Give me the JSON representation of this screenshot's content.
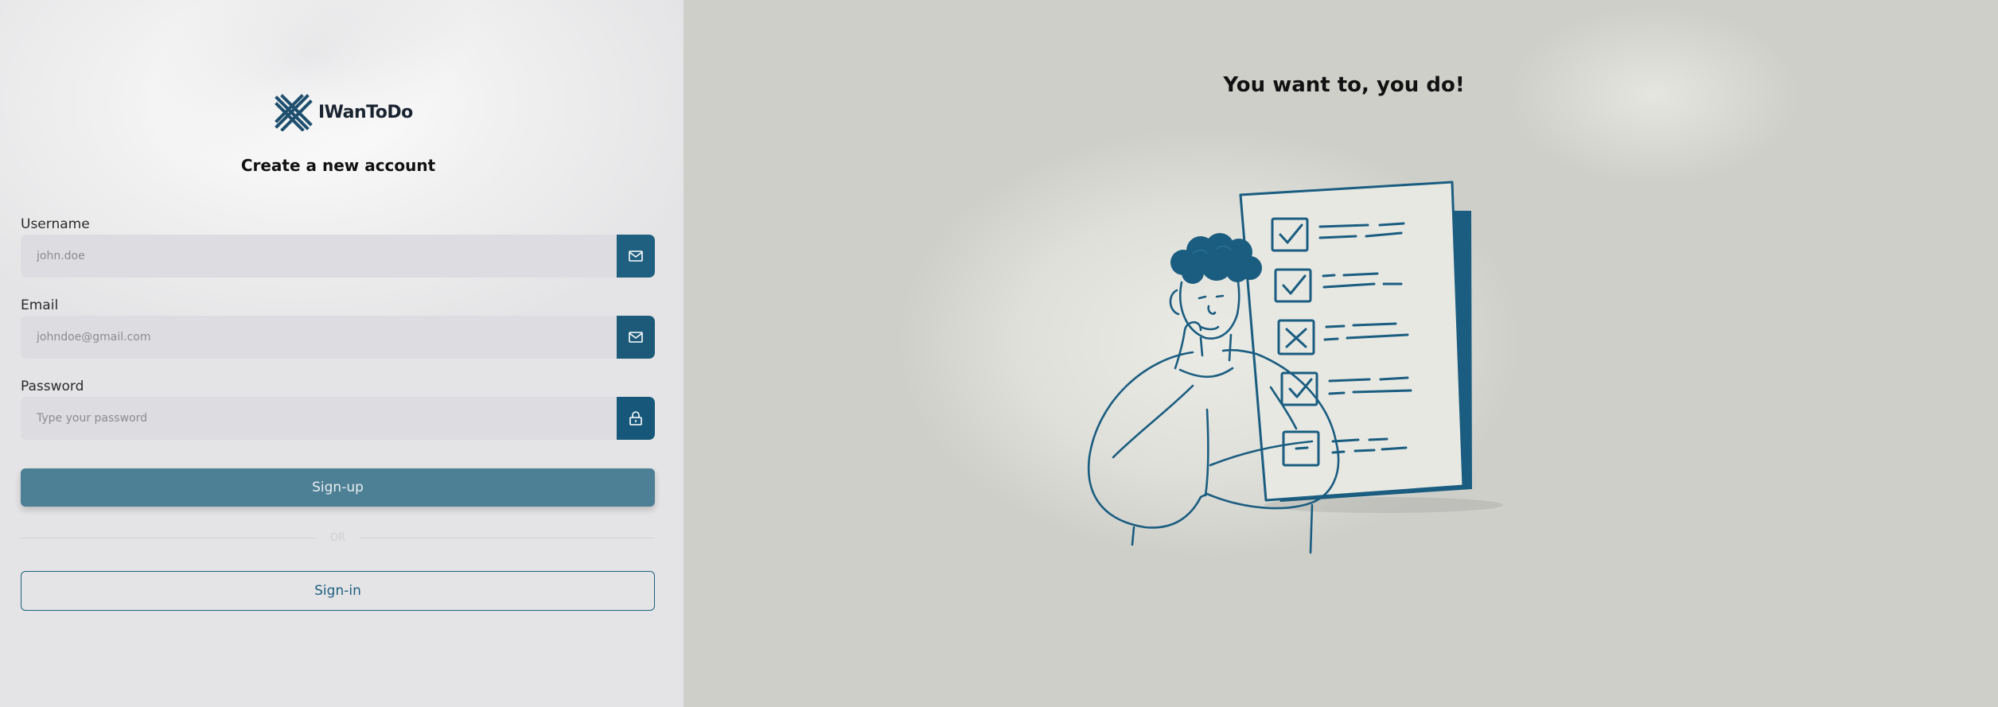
{
  "brand": {
    "name": "IWanToDo"
  },
  "form": {
    "title": "Create a new account",
    "username": {
      "label": "Username",
      "placeholder": "john.doe",
      "icon": "mail-icon"
    },
    "email": {
      "label": "Email",
      "placeholder": "johndoe@gmail.com",
      "icon": "mail-icon"
    },
    "password": {
      "label": "Password",
      "placeholder": "Type your password",
      "icon": "lock-icon"
    },
    "signup_label": "Sign-up",
    "divider_text": "OR",
    "signin_label": "Sign-in"
  },
  "hero": {
    "tagline": "You want to, you do!"
  },
  "colors": {
    "primary": "#1f5f80",
    "signup_button": "#4d7f95",
    "field_bg": "#dddde1",
    "right_bg": "#cfcfca"
  }
}
